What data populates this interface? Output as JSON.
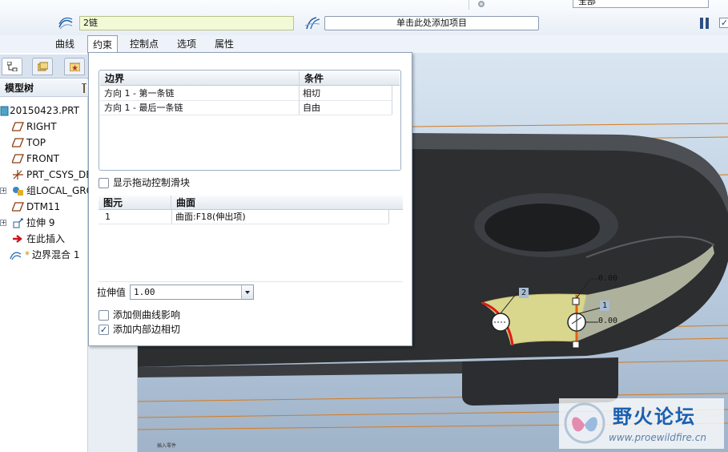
{
  "dashboard": {
    "chain_value": "2链",
    "add_item_placeholder": "单击此处添加项目",
    "top_select_value": "全部",
    "check_mark": "✓"
  },
  "tabs": [
    {
      "label": "曲线"
    },
    {
      "label": "约束"
    },
    {
      "label": "控制点"
    },
    {
      "label": "选项"
    },
    {
      "label": "属性"
    }
  ],
  "navigator": {
    "header": "模型树",
    "items": [
      {
        "label": "20150423.PRT",
        "icon": "part-icon"
      },
      {
        "label": "RIGHT",
        "icon": "datum-plane-icon"
      },
      {
        "label": "TOP",
        "icon": "datum-plane-icon"
      },
      {
        "label": "FRONT",
        "icon": "datum-plane-icon"
      },
      {
        "label": "PRT_CSYS_DEF",
        "icon": "csys-icon"
      },
      {
        "label": "组LOCAL_GROUP",
        "icon": "group-icon"
      },
      {
        "label": "DTM11",
        "icon": "datum-plane-icon"
      },
      {
        "label": "拉伸 9",
        "icon": "extrude-icon"
      },
      {
        "label": "在此插入",
        "icon": "insert-here-arrow-icon"
      },
      {
        "label": "边界混合 1",
        "icon": "boundary-blend-icon",
        "prefix": "*"
      }
    ]
  },
  "panel": {
    "boundary_table": {
      "headers": [
        "边界",
        "条件"
      ],
      "rows": [
        [
          "方向 1 - 第一条链",
          "相切"
        ],
        [
          "方向 1 - 最后一条链",
          "自由"
        ]
      ]
    },
    "show_drag_handles": {
      "label": "显示拖动控制滑块",
      "checked": false
    },
    "element_table": {
      "headers": [
        "图元",
        "曲面"
      ],
      "rows": [
        [
          "1",
          "曲面:F18(伸出项)"
        ]
      ]
    },
    "stretch": {
      "label": "拉伸值",
      "value": "1.00"
    },
    "add_side_curve_influence": {
      "label": "添加侧曲线影响",
      "checked": false
    },
    "add_inner_edge_tangency": {
      "label": "添加内部边相切",
      "checked": true,
      "mark": "✓"
    }
  },
  "viewport": {
    "dim_labels": [
      "2",
      "1",
      "0.00",
      "0.00"
    ],
    "corner_mark": "插入零件"
  },
  "watermark": {
    "title": "野火论坛",
    "url": "www.proewildfire.cn"
  }
}
